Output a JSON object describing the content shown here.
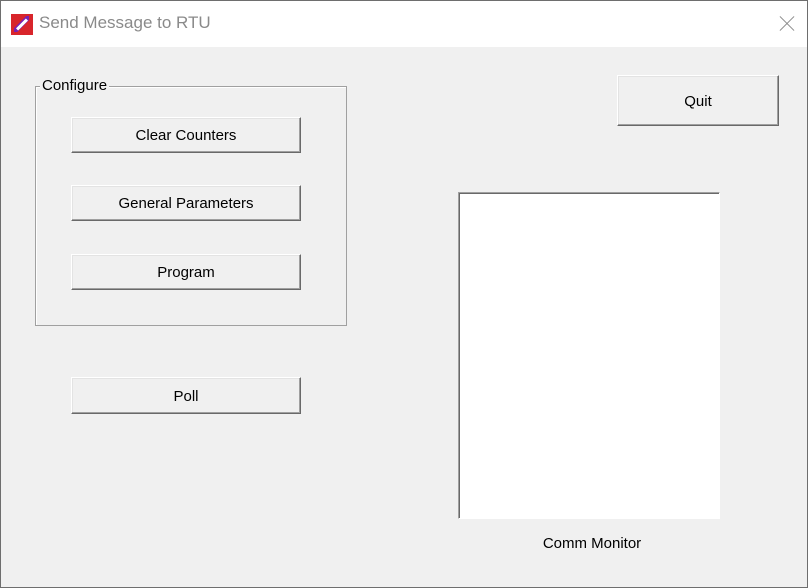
{
  "window": {
    "title": "Send Message to RTU",
    "app_icon": "rtu-app-icon",
    "close_icon": "close-icon"
  },
  "configure_group": {
    "label": "Configure",
    "buttons": [
      {
        "label": "Clear Counters"
      },
      {
        "label": "General Parameters"
      },
      {
        "label": "Program"
      }
    ]
  },
  "poll_button": {
    "label": "Poll"
  },
  "quit_button": {
    "label": "Quit"
  },
  "comm_monitor": {
    "label": "Comm Monitor",
    "content": ""
  },
  "colors": {
    "dialog_background": "#f0f0f0",
    "title_text": "#8a8a8a",
    "app_icon_accent": "#d8252b"
  }
}
